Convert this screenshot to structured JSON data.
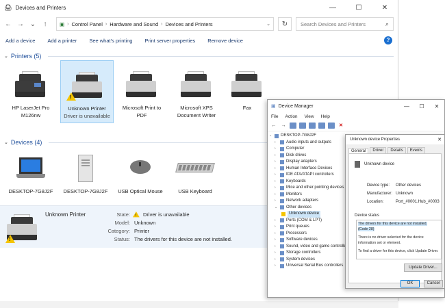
{
  "window": {
    "title": "Devices and Printers",
    "controls": [
      "—",
      "☐",
      "✕"
    ]
  },
  "address": {
    "crumbs": [
      "Control Panel",
      "Hardware and Sound",
      "Devices and Printers"
    ],
    "search_placeholder": "Search Devices and Printers"
  },
  "toolbar": {
    "items": [
      "Add a device",
      "Add a printer",
      "See what's printing",
      "Print server properties",
      "Remove device"
    ],
    "help": "?"
  },
  "printers": {
    "header": "Printers (5)",
    "items": [
      {
        "label": "HP LaserJet Pro",
        "sub": "M126nw"
      },
      {
        "label": "Unknown Printer",
        "sub": "Driver is unavailable"
      },
      {
        "label": "Microsoft Print to",
        "sub": "PDF"
      },
      {
        "label": "Microsoft XPS",
        "sub": "Document Writer"
      },
      {
        "label": "Fax",
        "sub": ""
      }
    ]
  },
  "devices": {
    "header": "Devices (4)",
    "items": [
      {
        "label": "DESKTOP-7G8J2F"
      },
      {
        "label": "DESKTOP-7G8J2F"
      },
      {
        "label": "USB Optical Mouse"
      },
      {
        "label": "USB Keyboard"
      }
    ]
  },
  "details": {
    "name": "Unknown Printer",
    "rows": [
      {
        "k": "State:",
        "v": "Driver is unavailable"
      },
      {
        "k": "Model:",
        "v": "Unknown"
      },
      {
        "k": "Category:",
        "v": "Printer"
      },
      {
        "k": "Status:",
        "v": "The drivers for this device are not installed."
      }
    ]
  },
  "device_manager": {
    "title": "Device Manager",
    "controls": [
      "—",
      "☐",
      "✕"
    ],
    "menu": [
      "File",
      "Action",
      "View",
      "Help"
    ],
    "tree_root": "DESKTOP-7G8J2F",
    "tree": [
      "Audio inputs and outputs",
      "Computer",
      "Disk drives",
      "Display adapters",
      "Human Interface Devices",
      "IDE ATA/ATAPI controllers",
      "Keyboards",
      "Mice and other pointing devices",
      "Monitors",
      "Network adapters",
      "Other devices"
    ],
    "tree_child": "Unknown device",
    "tree_after": [
      "Ports (COM & LPT)",
      "Print queues",
      "Processors",
      "Software devices",
      "Sound, video and game controllers",
      "Storage controllers",
      "System devices",
      "Universal Serial Bus controllers"
    ]
  },
  "properties": {
    "title": "Unknown device Properties",
    "tabs": [
      "General",
      "Driver",
      "Details",
      "Events"
    ],
    "device_name": "Unknown device",
    "info": [
      {
        "k": "Device type:",
        "v": "Other devices"
      },
      {
        "k": "Manufacturer:",
        "v": "Unknown"
      },
      {
        "k": "Location:",
        "v": "Port_#0001.Hub_#0003"
      }
    ],
    "status_label": "Device status",
    "status_line1": "The drivers for this device are not installed.",
    "status_line2": "(Code 28)",
    "status_line3": "There is no driver selected for the device information set or element.",
    "status_line4": "To find a driver for this device, click Update Driver.",
    "update_button": "Update Driver...",
    "ok": "OK",
    "cancel": "Cancel"
  }
}
